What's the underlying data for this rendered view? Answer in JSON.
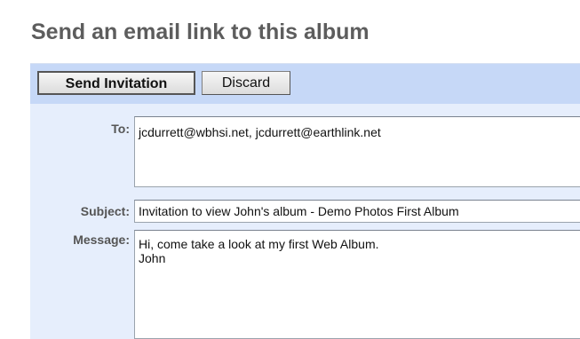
{
  "page": {
    "title": "Send an email link to this album"
  },
  "toolbar": {
    "send_label": "Send Invitation",
    "discard_label": "Discard"
  },
  "form": {
    "to_label": "To:",
    "to_value": "jcdurrett@wbhsi.net, jcdurrett@earthlink.net",
    "subject_label": "Subject:",
    "subject_value": "Invitation to view John's album - Demo Photos First Album",
    "message_label": "Message:",
    "message_value": "Hi, come take a look at my first Web Album.\nJohn"
  },
  "colors": {
    "title": "#5d5d5d",
    "toolbar_bg": "#c6d8f7",
    "panel_bg": "#e6eefc",
    "label": "#555555"
  }
}
